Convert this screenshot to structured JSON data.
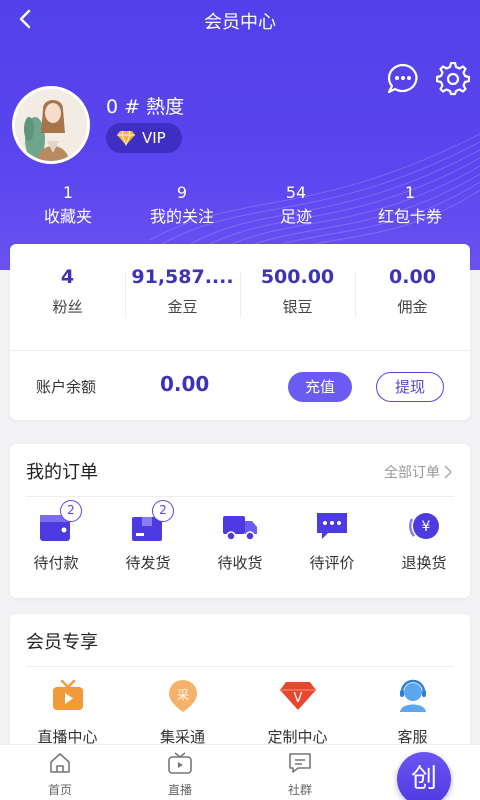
{
  "header": {
    "title": "会员中心"
  },
  "profile": {
    "username": "0 # 熱度",
    "vip_label": "VIP"
  },
  "stats": [
    {
      "num": "1",
      "label": "收藏夹"
    },
    {
      "num": "9",
      "label": "我的关注"
    },
    {
      "num": "54",
      "label": "足迹"
    },
    {
      "num": "1",
      "label": "红包卡券"
    }
  ],
  "wallet": {
    "items": [
      {
        "value": "4",
        "label": "粉丝"
      },
      {
        "value": "91,587....",
        "label": "金豆"
      },
      {
        "value": "500.00",
        "label": "银豆"
      },
      {
        "value": "0.00",
        "label": "佣金"
      }
    ],
    "balance_label": "账户余额",
    "balance_value": "0.00",
    "recharge_label": "充值",
    "withdraw_label": "提现"
  },
  "orders": {
    "title": "我的订单",
    "all_label": "全部订单",
    "items": [
      {
        "label": "待付款",
        "badge": "2"
      },
      {
        "label": "待发货",
        "badge": "2"
      },
      {
        "label": "待收货"
      },
      {
        "label": "待评价"
      },
      {
        "label": "退换货"
      }
    ]
  },
  "vip": {
    "title": "会员专享",
    "items": [
      {
        "label": "直播中心",
        "icon": "live-tv-icon"
      },
      {
        "label": "集采通",
        "icon": "collect-icon",
        "glyph": "采"
      },
      {
        "label": "定制中心",
        "icon": "gem-icon",
        "glyph": "V"
      },
      {
        "label": "客服",
        "icon": "customer-service-icon"
      }
    ]
  },
  "tabbar": {
    "items": [
      {
        "label": "首页",
        "icon": "home-icon"
      },
      {
        "label": "直播",
        "icon": "live-icon"
      },
      {
        "label": "社群",
        "icon": "community-icon"
      }
    ],
    "create_label": "创"
  },
  "colors": {
    "brand": "#5a45ee",
    "accent_text": "#3d33b8",
    "orange": "#f29a3a",
    "red": "#e8472f"
  }
}
